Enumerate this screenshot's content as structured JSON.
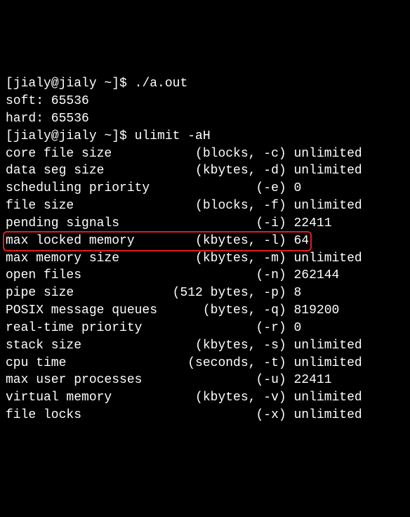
{
  "prompt1": "[jialy@jialy ~]$ ",
  "cmd1": "./a.out",
  "out_soft": "soft: 65536",
  "out_hard": "hard: 65536",
  "prompt2": "[jialy@jialy ~]$ ",
  "cmd2": "ulimit -aH",
  "rows": [
    {
      "name": "core file size",
      "units": "(blocks, -c)",
      "value": "unlimited"
    },
    {
      "name": "data seg size",
      "units": "(kbytes, -d)",
      "value": "unlimited"
    },
    {
      "name": "scheduling priority",
      "units": "(-e)",
      "value": "0"
    },
    {
      "name": "file size",
      "units": "(blocks, -f)",
      "value": "unlimited"
    },
    {
      "name": "pending signals",
      "units": "(-i)",
      "value": "22411"
    },
    {
      "name": "max locked memory",
      "units": "(kbytes, -l)",
      "value": "64"
    },
    {
      "name": "max memory size",
      "units": "(kbytes, -m)",
      "value": "unlimited"
    },
    {
      "name": "open files",
      "units": "(-n)",
      "value": "262144"
    },
    {
      "name": "pipe size",
      "units": "(512 bytes, -p)",
      "value": "8"
    },
    {
      "name": "POSIX message queues",
      "units": "(bytes, -q)",
      "value": "819200"
    },
    {
      "name": "real-time priority",
      "units": "(-r)",
      "value": "0"
    },
    {
      "name": "stack size",
      "units": "(kbytes, -s)",
      "value": "unlimited"
    },
    {
      "name": "cpu time",
      "units": "(seconds, -t)",
      "value": "unlimited"
    },
    {
      "name": "max user processes",
      "units": "(-u)",
      "value": "22411"
    },
    {
      "name": "virtual memory",
      "units": "(kbytes, -v)",
      "value": "unlimited"
    },
    {
      "name": "file locks",
      "units": "(-x)",
      "value": "unlimited"
    }
  ],
  "highlight_index": 5,
  "layout": {
    "col1_width": 22,
    "col2_width": 15
  }
}
